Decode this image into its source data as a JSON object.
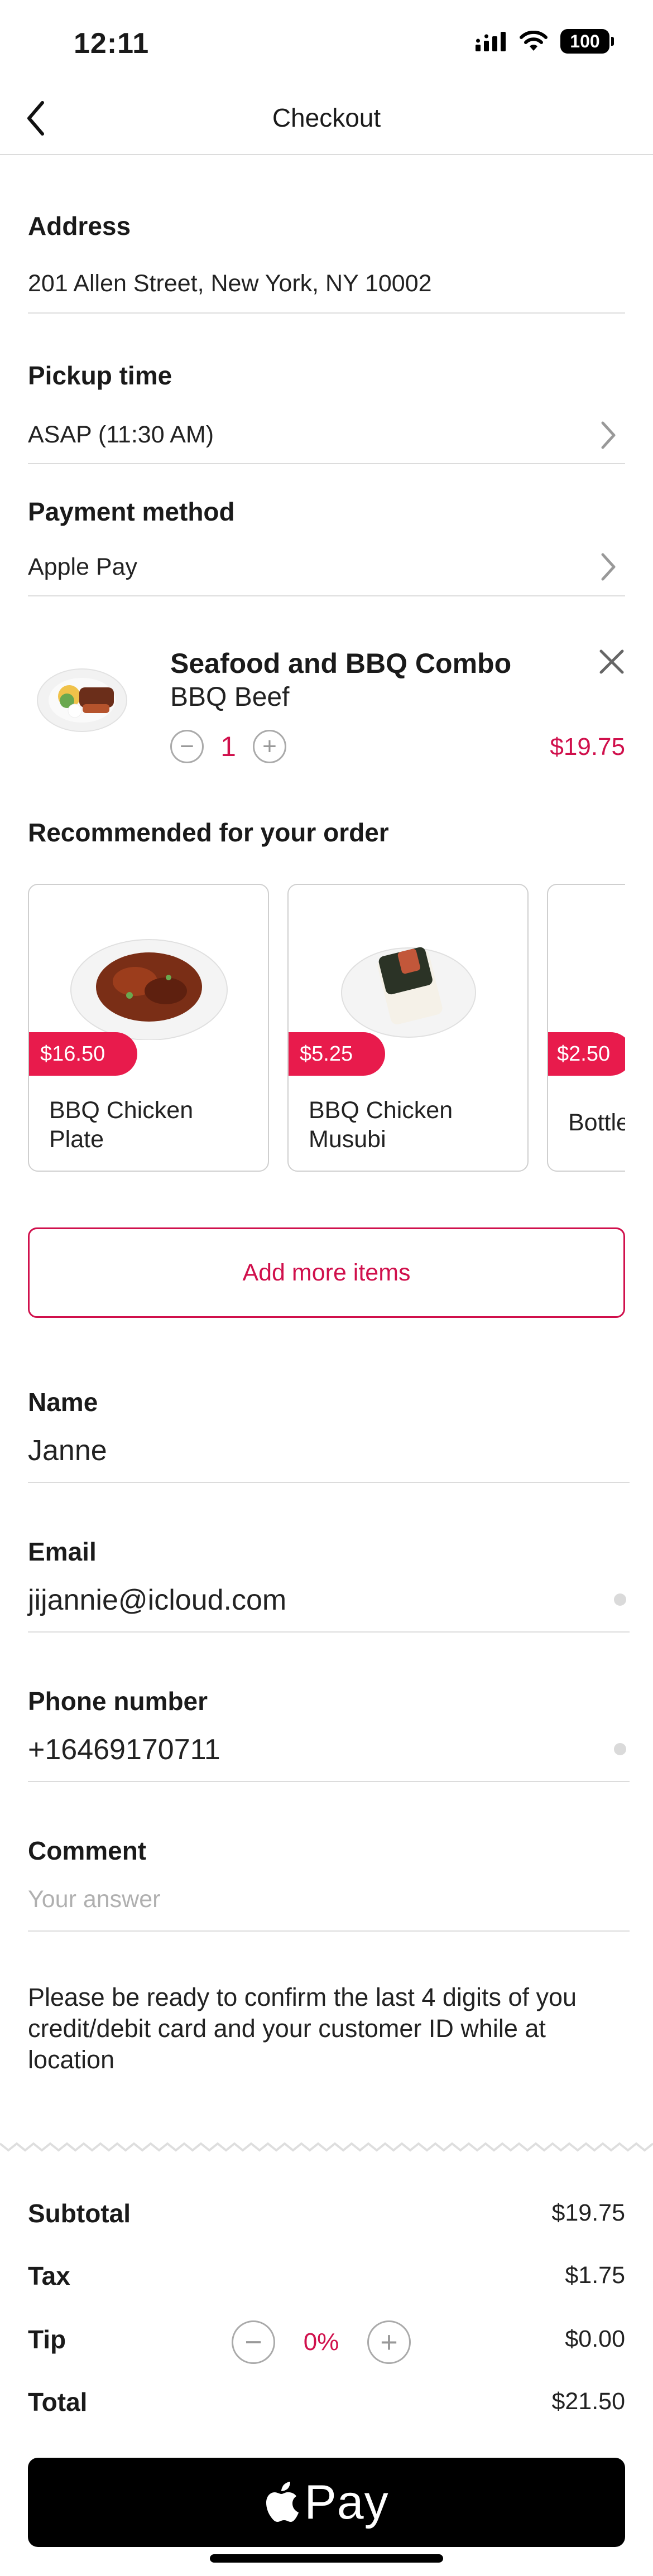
{
  "status_bar": {
    "time": "12:11",
    "battery": "100"
  },
  "nav": {
    "title": "Checkout"
  },
  "address": {
    "label": "Address",
    "value": "201 Allen Street, New York, NY 10002"
  },
  "pickup": {
    "label": "Pickup time",
    "value": "ASAP (11:30 AM)"
  },
  "payment": {
    "label": "Payment method",
    "value": "Apple Pay"
  },
  "cart_item": {
    "title": "Seafood and BBQ Combo",
    "option": "BBQ Beef",
    "quantity": "1",
    "price": "$19.75",
    "minus": "−",
    "plus": "+"
  },
  "recommended": {
    "heading": "Recommended for your order",
    "items": [
      {
        "price": "$16.50",
        "name": "BBQ Chicken Plate"
      },
      {
        "price": "$5.25",
        "name": "BBQ Chicken Musubi"
      },
      {
        "price": "$2.50",
        "name": "Bottle"
      }
    ]
  },
  "add_more": {
    "label": "Add more items"
  },
  "form": {
    "name": {
      "label": "Name",
      "value": "Janne"
    },
    "email": {
      "label": "Email",
      "value": "jijannie@icloud.com"
    },
    "phone": {
      "label": "Phone number",
      "value": "+16469170711"
    },
    "comment": {
      "label": "Comment",
      "placeholder": "Your answer"
    }
  },
  "notice": "Please be ready to confirm the last 4 digits of you credit/debit card and your customer ID while at location",
  "summary": {
    "subtotal": {
      "label": "Subtotal",
      "value": "$19.75"
    },
    "tax": {
      "label": "Tax",
      "value": "$1.75"
    },
    "tip": {
      "label": "Tip",
      "percent": "0%",
      "value": "$0.00",
      "minus": "−",
      "plus": "+"
    },
    "total": {
      "label": "Total",
      "value": "$21.50"
    }
  },
  "pay_button": {
    "label": "Pay"
  },
  "colors": {
    "accent": "#d0104c",
    "price_tag": "#e81b4c",
    "divider": "#dcdcdc"
  },
  "icons": [
    "back-chevron-icon",
    "signal-icon",
    "wifi-icon",
    "battery-icon",
    "chevron-right-icon",
    "close-icon",
    "minus-icon",
    "plus-icon",
    "apple-logo-icon"
  ]
}
